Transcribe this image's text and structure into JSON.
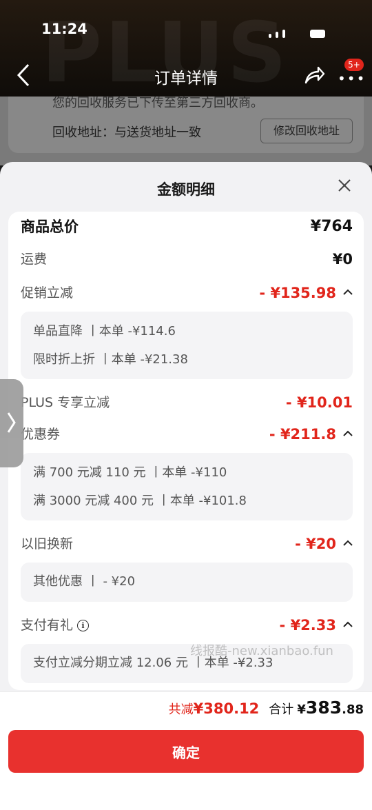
{
  "status_bar": {
    "time": "11:24"
  },
  "background": {
    "watermark": "PLUS",
    "nav_title": "订单详情",
    "badge": "5+",
    "notice_text": "您的回收服务已下传至第三方回收商。",
    "address_text": "回收地址：与送货地址一致",
    "modify_button": "修改回收地址"
  },
  "sheet": {
    "title": "金额明细",
    "rows": {
      "total": {
        "label": "商品总价",
        "value": "¥764"
      },
      "freight": {
        "label": "运费",
        "value": "¥0"
      },
      "promo": {
        "label": "促销立减",
        "value": "- ¥135.98",
        "details": [
          "单品直降 丨本单 -¥114.6",
          "限时折上折 丨本单 -¥21.38"
        ]
      },
      "plus": {
        "label": "PLUS 专享立减",
        "value": "- ¥10.01"
      },
      "coupon": {
        "label": "优惠券",
        "value": "- ¥211.8",
        "details": [
          "满 700 元减 110 元 丨本单 -¥110",
          "满 3000 元减 400 元 丨本单 -¥101.8"
        ]
      },
      "tradein": {
        "label": "以旧换新",
        "value": "- ¥20",
        "details": [
          "其他优惠 丨 - ¥20"
        ]
      },
      "payment": {
        "label": "支付有礼",
        "value": "- ¥2.33",
        "details": [
          "支付立减分期立减 12.06 元 丨本单 -¥2.33"
        ]
      }
    },
    "watermark_site": "线报酷-new.xianbao.fun"
  },
  "footer": {
    "saved_label": "共减",
    "saved_value": "¥380.12",
    "total_label": "合计",
    "total_currency": "¥",
    "total_int": "383",
    "total_dec": ".88",
    "confirm_label": "确定"
  },
  "colors": {
    "accent": "#e1251b",
    "button": "#e8312e",
    "sheet_bg": "#f2f2f4"
  }
}
